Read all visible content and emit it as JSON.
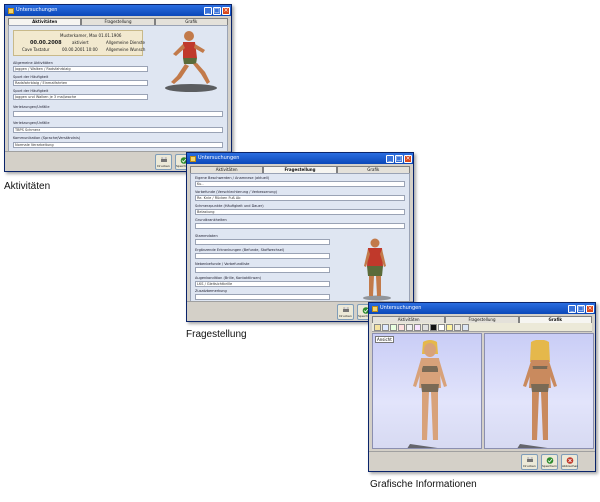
{
  "windows": {
    "activities": {
      "title": "Untersuchungen",
      "tabs": [
        "Aktivitäten",
        "Fragestellung",
        "Grafik"
      ],
      "active_tab": 0,
      "card": {
        "name": "Musterkamer, Max  01.01.1906",
        "date": "00.00.2008",
        "status": "aktiviert",
        "sub1": "Cave Tastatur",
        "sub2": "00.00.2001  10:00",
        "col1": "Allgemeine Dienste",
        "col2": "Allgemeine Wunsch"
      },
      "fields": [
        {
          "label": "Allgemeine Aktivitäten",
          "value": "Joggen / Walken / Radsfahrblaig"
        },
        {
          "label": "Sport der Häufigkeit",
          "value": "Radsfahrblaig / Einmalfahrten"
        },
        {
          "label": "Sport der Häufigkeit",
          "value": "Joggen und Walken je 3 mal/woche"
        },
        {
          "label": "Verletzungen/Unfälle",
          "value": ""
        },
        {
          "label": "Verletzungen/Unfälle",
          "value": "TBPS Schmerz"
        },
        {
          "label": "Kommunikation (Sprache/Verständnis)",
          "value": "Normale Verarbeitung"
        }
      ],
      "footer_buttons": [
        "Drucken",
        "Speichern"
      ]
    },
    "questions": {
      "title": "Untersuchungen",
      "tabs": [
        "Aktivitäten",
        "Fragestellung",
        "Grafik"
      ],
      "active_tab": 1,
      "fields": [
        {
          "label": "Eigene Beschwerden / Anamnese (aktuell)",
          "value": "Ku.."
        },
        {
          "label": "Vorbefunde (Verschlechterung / Verbesserung)",
          "value": "Re. Knie / Rücken Fuß Ab"
        },
        {
          "label": "Schmerzpunkte (Häufigkeit und Dauer)",
          "value": "Belastung"
        },
        {
          "label": "Grundkrankheiten",
          "value": ""
        },
        {
          "label": "Stammdaten",
          "value": ""
        },
        {
          "label": "Ergänzende Erkrankungen (Befunde, Stoffwechsel)",
          "value": ""
        },
        {
          "label": "Nebenbefunde / Vorbefundliste",
          "value": ""
        },
        {
          "label": "Augenkondition (Brille, Kontaktlinsen)",
          "value": "LKS / Gleitsichtbrille"
        },
        {
          "label": "Zusatzbemerkung",
          "value": ""
        }
      ],
      "footer_buttons": [
        "Drucken",
        "Speichern"
      ]
    },
    "graphics": {
      "title": "Untersuchungen",
      "tabs": [
        "Aktivitäten",
        "Fragestellung",
        "Grafik"
      ],
      "active_tab": 2,
      "viewport_tag": "Ansicht",
      "footer_buttons": [
        "Drucken",
        "Speichern",
        "Abbrechen"
      ]
    }
  },
  "captions": {
    "activities": "Aktivitäten",
    "questions": "Fragestellung",
    "graphics": "Grafische Informationen"
  },
  "colors": {
    "title_bar": "#0b47b8",
    "content_bg": "#dfe6f2",
    "card_bg": "#f2e9cf",
    "save_green": "#2e8b2e",
    "cancel_red": "#c0392b"
  }
}
